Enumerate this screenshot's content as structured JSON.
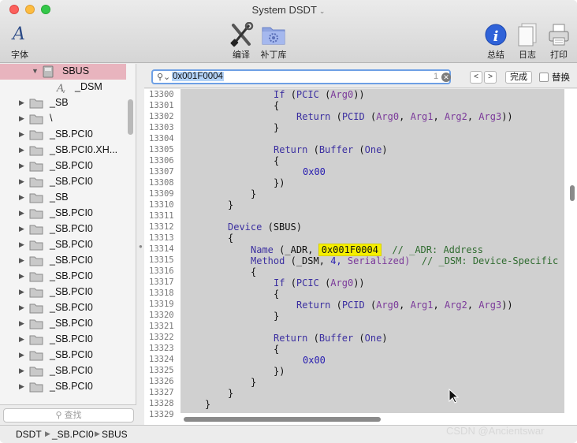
{
  "window": {
    "title": "System DSDT"
  },
  "toolbar": {
    "font_label": "字体",
    "compile_label": "编译",
    "patch_label": "补丁库",
    "summary_label": "总结",
    "log_label": "日志",
    "print_label": "打印"
  },
  "sidebar": {
    "selected": "SBUS",
    "child": "_DSM",
    "items": [
      "_SB",
      "\\",
      "_SB.PCI0",
      "_SB.PCI0.XH...",
      "_SB.PCI0",
      "_SB.PCI0",
      "_SB",
      "_SB.PCI0",
      "_SB.PCI0",
      "_SB.PCI0",
      "_SB.PCI0",
      "_SB.PCI0",
      "_SB.PCI0",
      "_SB.PCI0",
      "_SB.PCI0",
      "_SB.PCI0",
      "_SB.PCI0",
      "_SB.PCI0",
      "_SB.PCI0"
    ],
    "filter_placeholder": "查找"
  },
  "search": {
    "query": "0x001F0004",
    "count": "1",
    "prev": "<",
    "next": ">",
    "done_label": "完成",
    "replace_label": "替换"
  },
  "editor": {
    "line_numbers": [
      "13300",
      "13301",
      "13302",
      "13303",
      "13304",
      "13305",
      "13306",
      "13307",
      "13308",
      "13309",
      "13310",
      "13311",
      "13312",
      "13313",
      "13314",
      "13315",
      "13316",
      "13317",
      "13318",
      "13319",
      "13320",
      "13321",
      "13322",
      "13323",
      "13324",
      "13325",
      "13326",
      "13327",
      "13328",
      "13329"
    ],
    "code": {
      "if": "If",
      "pcic": "PCIC",
      "arg0": "Arg0",
      "arg1": "Arg1",
      "arg2": "Arg2",
      "arg3": "Arg3",
      "ret": "Return",
      "pcid": "PCID",
      "buffer": "Buffer",
      "one": "One",
      "zero_hex": "0x00",
      "device": "Device",
      "sbus_paren": "(SBUS)",
      "name": "Name",
      "adr": "(_ADR,",
      "adr_value": "0x001F0004",
      "adr_comment": "// _ADR: Address",
      "method": "Method",
      "dsm": "(_DSM,",
      "four": "4,",
      "serialized": "Serialized)",
      "dsm_comment": "// _DSM: Device-Specific"
    }
  },
  "status": {
    "crumbs": [
      "DSDT",
      "_SB.PCI0",
      "SBUS"
    ]
  },
  "watermark": "CSDN @Ancientswar"
}
